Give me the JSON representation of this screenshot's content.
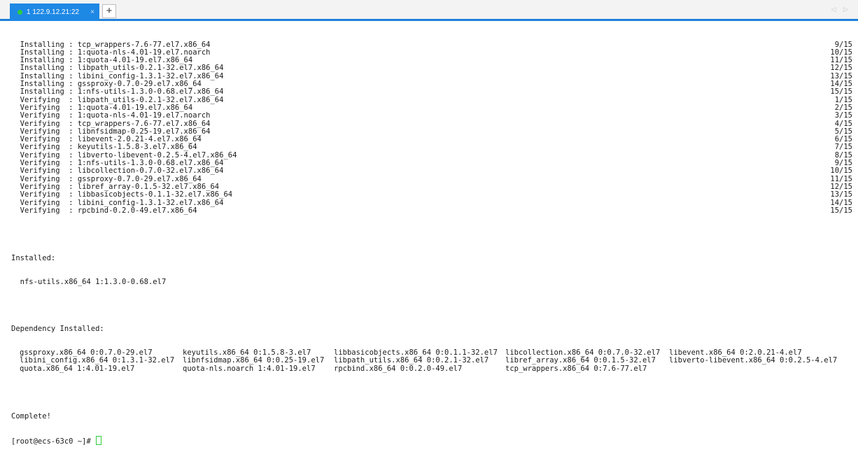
{
  "tab": {
    "title": "1 122.9.12.21:22",
    "close": "×"
  },
  "add_tab": "+",
  "scroll_arrows": "◁ ▷",
  "transaction_lines": [
    {
      "action": "Installing",
      "package": "tcp_wrappers-7.6-77.el7.x86_64",
      "count": "9/15"
    },
    {
      "action": "Installing",
      "package": "1:quota-nls-4.01-19.el7.noarch",
      "count": "10/15"
    },
    {
      "action": "Installing",
      "package": "1:quota-4.01-19.el7.x86_64",
      "count": "11/15"
    },
    {
      "action": "Installing",
      "package": "libpath_utils-0.2.1-32.el7.x86_64",
      "count": "12/15"
    },
    {
      "action": "Installing",
      "package": "libini_config-1.3.1-32.el7.x86_64",
      "count": "13/15"
    },
    {
      "action": "Installing",
      "package": "gssproxy-0.7.0-29.el7.x86_64",
      "count": "14/15"
    },
    {
      "action": "Installing",
      "package": "1:nfs-utils-1.3.0-0.68.el7.x86_64",
      "count": "15/15"
    },
    {
      "action": "Verifying ",
      "package": "libpath_utils-0.2.1-32.el7.x86_64",
      "count": "1/15"
    },
    {
      "action": "Verifying ",
      "package": "1:quota-4.01-19.el7.x86_64",
      "count": "2/15"
    },
    {
      "action": "Verifying ",
      "package": "1:quota-nls-4.01-19.el7.noarch",
      "count": "3/15"
    },
    {
      "action": "Verifying ",
      "package": "tcp_wrappers-7.6-77.el7.x86_64",
      "count": "4/15"
    },
    {
      "action": "Verifying ",
      "package": "libnfsidmap-0.25-19.el7.x86_64",
      "count": "5/15"
    },
    {
      "action": "Verifying ",
      "package": "libevent-2.0.21-4.el7.x86_64",
      "count": "6/15"
    },
    {
      "action": "Verifying ",
      "package": "keyutils-1.5.8-3.el7.x86_64",
      "count": "7/15"
    },
    {
      "action": "Verifying ",
      "package": "libverto-libevent-0.2.5-4.el7.x86_64",
      "count": "8/15"
    },
    {
      "action": "Verifying ",
      "package": "1:nfs-utils-1.3.0-0.68.el7.x86_64",
      "count": "9/15"
    },
    {
      "action": "Verifying ",
      "package": "libcollection-0.7.0-32.el7.x86_64",
      "count": "10/15"
    },
    {
      "action": "Verifying ",
      "package": "gssproxy-0.7.0-29.el7.x86_64",
      "count": "11/15"
    },
    {
      "action": "Verifying ",
      "package": "libref_array-0.1.5-32.el7.x86_64",
      "count": "12/15"
    },
    {
      "action": "Verifying ",
      "package": "libbasicobjects-0.1.1-32.el7.x86_64",
      "count": "13/15"
    },
    {
      "action": "Verifying ",
      "package": "libini_config-1.3.1-32.el7.x86_64",
      "count": "14/15"
    },
    {
      "action": "Verifying ",
      "package": "rpcbind-0.2.0-49.el7.x86_64",
      "count": "15/15"
    }
  ],
  "installed": {
    "header": "Installed:",
    "items": [
      "nfs-utils.x86_64 1:1.3.0-0.68.el7"
    ]
  },
  "dependency": {
    "header": "Dependency Installed:",
    "rows": [
      [
        "gssproxy.x86_64 0:0.7.0-29.el7",
        "keyutils.x86_64 0:1.5.8-3.el7",
        "libbasicobjects.x86_64 0:0.1.1-32.el7",
        "libcollection.x86_64 0:0.7.0-32.el7",
        "libevent.x86_64 0:2.0.21-4.el7"
      ],
      [
        "libini_config.x86_64 0:1.3.1-32.el7",
        "libnfsidmap.x86_64 0:0.25-19.el7",
        "libpath_utils.x86_64 0:0.2.1-32.el7",
        "libref_array.x86_64 0:0.1.5-32.el7",
        "libverto-libevent.x86_64 0:0.2.5-4.el7"
      ],
      [
        "quota.x86_64 1:4.01-19.el7",
        "quota-nls.noarch 1:4.01-19.el7",
        "rpcbind.x86_64 0:0.2.0-49.el7",
        "tcp_wrappers.x86_64 0:7.6-77.el7",
        ""
      ]
    ]
  },
  "complete": "Complete!",
  "prompt": "[root@ecs-63c0 ~]# "
}
